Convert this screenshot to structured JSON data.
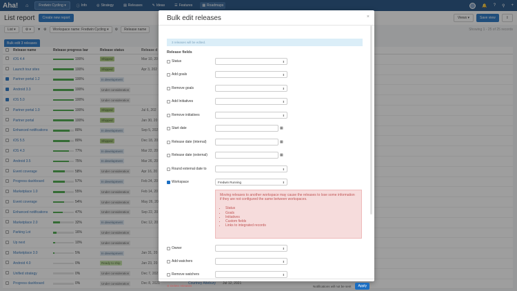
{
  "nav": {
    "logo": "Aha!",
    "workspace": "Fredwin Cycling ▾",
    "items": [
      "Info",
      "Strategy",
      "Releases",
      "Ideas",
      "Features",
      "Roadmaps"
    ],
    "icons": {
      "info": "ⓘ",
      "strategy": "◎",
      "releases": "▤",
      "ideas": "✎",
      "features": "☰",
      "roadmaps": "▦",
      "bell": "🔔",
      "help": "?",
      "search": "⚲",
      "add": "+"
    }
  },
  "header": {
    "title": "List report",
    "create_label": "Create new report",
    "views_label": "Views ▾",
    "save_view_label": "Save view"
  },
  "filters": {
    "list_label": "List ▾",
    "gear_label": "⚙ ▾",
    "filter_icon": "▼",
    "workspace_filter": "Workspace name: Fredwin Cycling ▾",
    "release_filter": "Release name",
    "count_text": "Showing 1 - 25 of 25 records"
  },
  "bulk_button": "Bulk edit 3 releases",
  "table": {
    "headers": [
      "Release name",
      "Release progress bar",
      "Release status",
      "Release d"
    ],
    "rows": [
      {
        "name": "iOS 4.4",
        "progress": 100,
        "status": "Shipped",
        "date": "Mar 10, 20",
        "checked": false
      },
      {
        "name": "Launch tour sites",
        "progress": 100,
        "status": "Shipped",
        "date": "Apr 3, 202",
        "checked": false
      },
      {
        "name": "Partner portal 1.2",
        "progress": 100,
        "status": "In development",
        "date": "",
        "checked": true
      },
      {
        "name": "Android 3.3",
        "progress": 100,
        "status": "Under consideration",
        "date": "",
        "checked": true
      },
      {
        "name": "iOS 5.0",
        "progress": 100,
        "status": "Under consideration",
        "date": "",
        "checked": true
      },
      {
        "name": "Partner portal 1.0",
        "progress": 100,
        "status": "Shipped",
        "date": "Jul 6, 202",
        "checked": false
      },
      {
        "name": "Partner portal",
        "progress": 100,
        "status": "Shipped",
        "date": "Jan 30, 20",
        "checked": false
      },
      {
        "name": "Enhanced notifications",
        "progress": 80,
        "status": "In development",
        "date": "Sep 5, 202",
        "checked": false
      },
      {
        "name": "iOS 5.5",
        "progress": 80,
        "status": "Shipped",
        "date": "Dec 18, 20",
        "checked": false
      },
      {
        "name": "iOS 4.3",
        "progress": 77,
        "status": "In development",
        "date": "Mar 22, 20",
        "checked": false
      },
      {
        "name": "Android 3.5",
        "progress": 75,
        "status": "In development",
        "date": "Mar 26, 20",
        "checked": false
      },
      {
        "name": "Event coverage",
        "progress": 58,
        "status": "Under consideration",
        "date": "Apr 16, 20",
        "checked": false
      },
      {
        "name": "Progress dashboard",
        "progress": 57,
        "status": "In development",
        "date": "Feb 24, 20",
        "checked": false
      },
      {
        "name": "Marketplace 1.0",
        "progress": 55,
        "status": "Under consideration",
        "date": "Feb 14, 20",
        "checked": false
      },
      {
        "name": "Event coverage",
        "progress": 54,
        "status": "Under consideration",
        "date": "May 26, 20",
        "checked": false
      },
      {
        "name": "Enhanced notifications",
        "progress": 47,
        "status": "Under consideration",
        "date": "Sep 22, 20",
        "checked": false
      },
      {
        "name": "Marketplace 2.0",
        "progress": 32,
        "status": "In development",
        "date": "Dec 12, 20",
        "checked": false
      },
      {
        "name": "Parking Lot",
        "progress": 16,
        "status": "Under consideration",
        "date": "",
        "checked": false
      },
      {
        "name": "Up next",
        "progress": 10,
        "status": "Under consideration",
        "date": "",
        "checked": false
      },
      {
        "name": "Marketplace 3.0",
        "progress": 5,
        "status": "In development",
        "date": "Jan 31, 20",
        "checked": false
      },
      {
        "name": "Android 4.0",
        "progress": 0,
        "status": "Ready to ship",
        "date": "Jan 23, 20",
        "checked": false
      },
      {
        "name": "Unified strategy",
        "progress": 0,
        "status": "Under consideration",
        "date": "Dec 7, 202",
        "checked": false
      },
      {
        "name": "Progress dashboard",
        "progress": 0,
        "status": "Under consideration",
        "date": "Dec 8, 2021",
        "checked": false
      }
    ],
    "last_row_extra": {
      "person": "Courtney Attebury",
      "date2": "Jul 12, 2021"
    }
  },
  "modal": {
    "title": "Bulk edit releases",
    "close": "×",
    "info": "3 releases will be edited.",
    "section": "Release fields",
    "fields": {
      "status": "Status",
      "add_goals": "Add goals",
      "remove_goals": "Remove goals",
      "add_initiatives": "Add Initiatives",
      "remove_initiatives": "Remove initiatives",
      "start_date": "Start date",
      "release_internal": "Release date (internal)",
      "release_external": "Release date (external)",
      "round_external": "Round external date to",
      "workspace": "Workspace",
      "owner": "Owner",
      "add_watchers": "Add watchers",
      "remove_watchers": "Remove watchers"
    },
    "workspace_value": "Fredwin Running",
    "warning": {
      "text": "Moving releases to another workspace may cause the releases to lose some information if they are not configured the same between workspaces.",
      "items": [
        "Status",
        "Goals",
        "Initiatives",
        "Custom fields",
        "Links to integrated records"
      ]
    },
    "footer": {
      "delete": "⊖ Delete releases",
      "notify": "Notifications will not be sent",
      "apply": "Apply"
    }
  }
}
